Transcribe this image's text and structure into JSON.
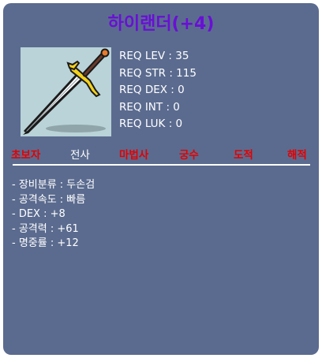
{
  "item": {
    "name": "하이랜더(+4)",
    "image_icon": "two-handed-sword-icon"
  },
  "requirements": [
    "REQ LEV : 35",
    "REQ STR : 115",
    "REQ DEX : 0",
    "REQ INT : 0",
    "REQ LUK : 0"
  ],
  "jobs": [
    {
      "label": "초보자",
      "allowed": false
    },
    {
      "label": "전사",
      "allowed": true
    },
    {
      "label": "마법사",
      "allowed": false
    },
    {
      "label": "궁수",
      "allowed": false
    },
    {
      "label": "도적",
      "allowed": false
    },
    {
      "label": "해적",
      "allowed": false
    }
  ],
  "stats": [
    "- 장비분류 : 두손검",
    "- 공격속도 : 빠름",
    "- DEX : +8",
    "- 공격력 : +61",
    "- 명중률 : +12"
  ],
  "colors": {
    "panel": "#5b6b8f",
    "title": "#6a0fd6",
    "disallowed_job": "#e40000",
    "allowed_job": "#ffffff"
  }
}
